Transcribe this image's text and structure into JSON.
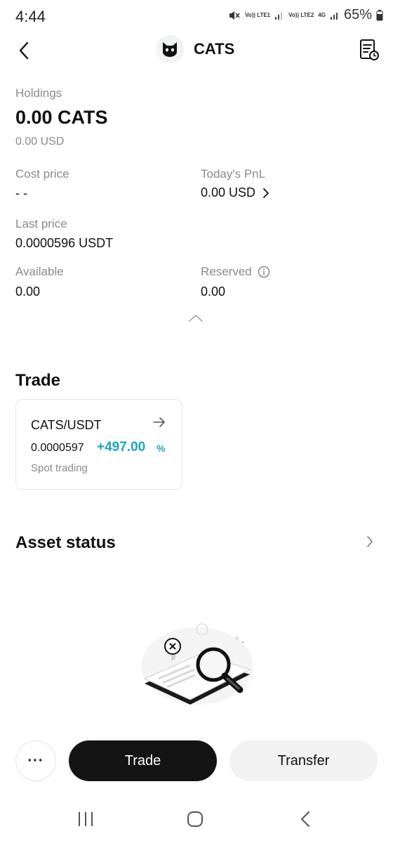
{
  "status_bar": {
    "time": "4:44",
    "sim1": "Vo)) LTE1",
    "sim2": "Vo)) LTE2",
    "network": "4G",
    "battery": "65%"
  },
  "header": {
    "title": "CATS",
    "logo_icon": "cat-icon",
    "back_icon": "chevron-left-icon",
    "history_icon": "order-history-icon"
  },
  "holdings": {
    "label": "Holdings",
    "amount": "0.00 CATS",
    "usd": "0.00 USD"
  },
  "stats": {
    "cost_price_label": "Cost price",
    "cost_price_value": "- -",
    "pnl_label": "Today's PnL",
    "pnl_value": "0.00 USD",
    "last_price_label": "Last price",
    "last_price_value": "0.0000596 USDT",
    "available_label": "Available",
    "available_value": "0.00",
    "reserved_label": "Reserved",
    "reserved_value": "0.00"
  },
  "trade": {
    "section_title": "Trade",
    "card": {
      "pair": "CATS/USDT",
      "price": "0.0000597",
      "change": "+497.00",
      "change_unit": "%",
      "type": "Spot trading"
    }
  },
  "asset_status": {
    "section_title": "Asset status"
  },
  "actions": {
    "more_label": "···",
    "trade_label": "Trade",
    "transfer_label": "Transfer"
  },
  "colors": {
    "accent_teal": "#1aa6c0",
    "primary_dark": "#141414",
    "muted_text": "#8a8a8a"
  }
}
